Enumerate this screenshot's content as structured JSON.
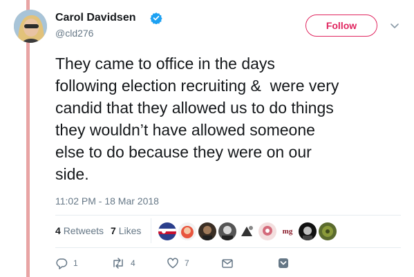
{
  "author": {
    "name": "Carol Davidsen",
    "handle": "@cld276",
    "verified": true
  },
  "follow_button": {
    "label": "Follow"
  },
  "tweet": {
    "text": "They came to office in the days\nfollowing election recruiting &  were very\ncandid that they allowed us to do things\nthey wouldn’t have allowed someone\nelse to do because they were on our\nside.",
    "timestamp": "11:02 PM - 18 Mar 2018"
  },
  "stats": {
    "retweets_count": "4",
    "retweets_label": "Retweets",
    "likes_count": "7",
    "likes_label": "Likes"
  },
  "liker_avatars": [
    "flag-avatar",
    "face-avatar",
    "dark-avatar",
    "bw-avatar",
    "cartoon-avatar",
    "pink-avatar",
    "mg-logo-avatar",
    "portrait-avatar",
    "green-avatar"
  ],
  "liker_logo_text": "mg",
  "actions": {
    "reply_count": "1",
    "retweet_count": "4",
    "like_count": "7"
  },
  "colors": {
    "follow": "#e0245e",
    "verified": "#1da1f2",
    "muted": "#657786",
    "side_bar": "#e8a4a4"
  },
  "icons": [
    "verified-badge-icon",
    "chevron-down-icon",
    "reply-icon",
    "retweet-icon",
    "like-icon",
    "direct-message-icon",
    "bookmark-icon"
  ]
}
